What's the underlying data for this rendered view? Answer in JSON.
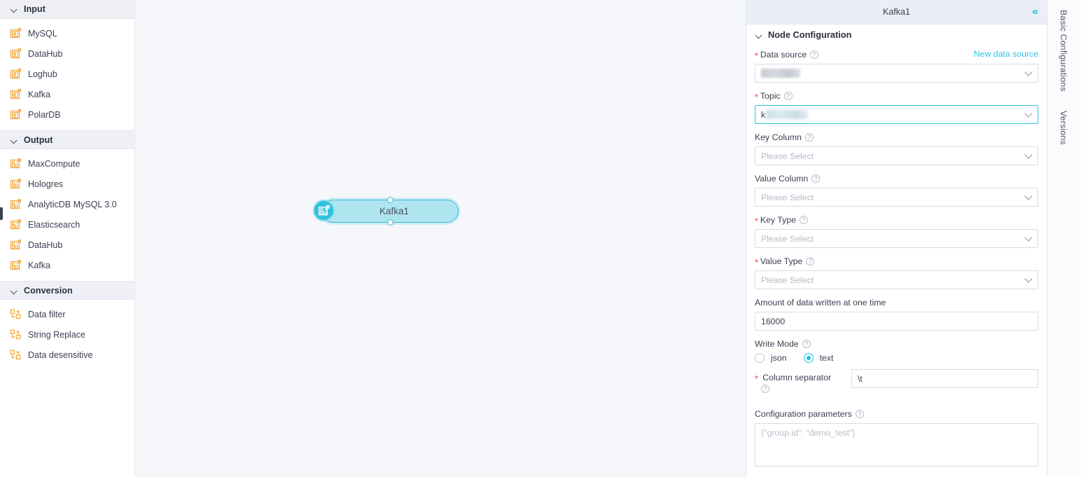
{
  "sidebar": {
    "sections": [
      {
        "title": "Input",
        "icon": "input-node-icon",
        "items": [
          {
            "label": "MySQL"
          },
          {
            "label": "DataHub"
          },
          {
            "label": "Loghub"
          },
          {
            "label": "Kafka"
          },
          {
            "label": "PolarDB"
          }
        ]
      },
      {
        "title": "Output",
        "icon": "output-node-icon",
        "items": [
          {
            "label": "MaxCompute"
          },
          {
            "label": "Hologres"
          },
          {
            "label": "AnalyticDB MySQL 3.0"
          },
          {
            "label": "Elasticsearch"
          },
          {
            "label": "DataHub"
          },
          {
            "label": "Kafka"
          }
        ]
      },
      {
        "title": "Conversion",
        "icon": "conversion-node-icon",
        "items": [
          {
            "label": "Data filter"
          },
          {
            "label": "String Replace"
          },
          {
            "label": "Data desensitive"
          }
        ]
      }
    ]
  },
  "canvas": {
    "node": {
      "label": "Kafka1",
      "icon": "kafka-output-node-icon",
      "border_color": "#35b9d4",
      "fill_color": "#aee5ef"
    }
  },
  "panel": {
    "title": "Kafka1",
    "collapse_icon": "«",
    "section_title": "Node Configuration",
    "fields": {
      "data_source": {
        "label": "Data source",
        "required": true,
        "value": "",
        "redacted": true,
        "new_link": "New data source"
      },
      "topic": {
        "label": "Topic",
        "required": true,
        "value": "k",
        "redacted": true,
        "focused": true
      },
      "key_column": {
        "label": "Key Column",
        "required": false,
        "placeholder": "Please Select"
      },
      "value_column": {
        "label": "Value Column",
        "required": false,
        "placeholder": "Please Select"
      },
      "key_type": {
        "label": "Key Type",
        "required": true,
        "placeholder": "Please Select"
      },
      "value_type": {
        "label": "Value Type",
        "required": true,
        "placeholder": "Please Select"
      },
      "amount": {
        "label": "Amount of data written at one time",
        "required": false,
        "value": "16000"
      },
      "write_mode": {
        "label": "Write Mode",
        "required": false,
        "options": [
          {
            "label": "json",
            "checked": false
          },
          {
            "label": "text",
            "checked": true
          }
        ]
      },
      "column_separator": {
        "label": "Column separator",
        "required": true,
        "value": "\\t"
      },
      "configuration_parameters": {
        "label": "Configuration parameters",
        "required": false,
        "placeholder": "{\"group.id\": \"demo_test\"}",
        "value": ""
      }
    }
  },
  "tab_rail": {
    "tabs": [
      {
        "label": "Basic Configurations"
      },
      {
        "label": "Versions"
      }
    ]
  },
  "colors": {
    "accent": "#2ec3e0",
    "node_border": "#35b9d4",
    "icon_orange": "#f0a73c",
    "required_red": "#e8443a"
  }
}
